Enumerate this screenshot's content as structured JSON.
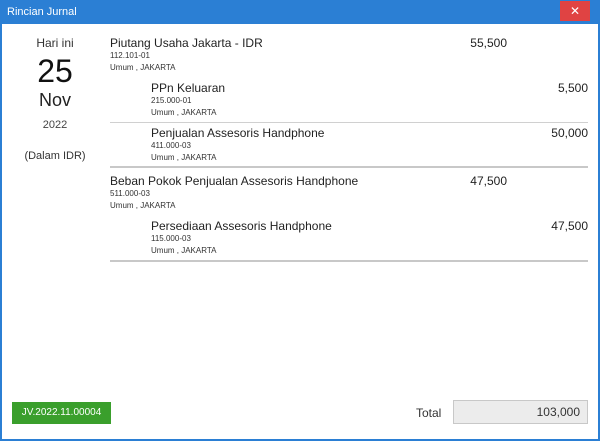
{
  "window": {
    "title": "Rincian Jurnal",
    "close_glyph": "✕",
    "close_icon": "close-icon"
  },
  "date_panel": {
    "label": "Hari ini",
    "day": "25",
    "month": "Nov",
    "year": "2022",
    "currency_note": "(Dalam IDR)"
  },
  "entries": [
    {
      "name": "Piutang Usaha Jakarta - IDR",
      "code": "112.101-01",
      "dept": "Umum , JAKARTA",
      "debit": "55,500",
      "credit": ""
    },
    {
      "name": "PPn Keluaran",
      "code": "215.000-01",
      "dept": "Umum , JAKARTA",
      "debit": "",
      "credit": "5,500"
    },
    {
      "name": "Penjualan Assesoris Handphone",
      "code": "411.000-03",
      "dept": "Umum , JAKARTA",
      "debit": "",
      "credit": "50,000"
    },
    {
      "name": "Beban Pokok Penjualan Assesoris Handphone",
      "code": "511.000-03",
      "dept": "Umum , JAKARTA",
      "debit": "47,500",
      "credit": ""
    },
    {
      "name": "Persediaan Assesoris Handphone",
      "code": "115.000-03",
      "dept": "Umum , JAKARTA",
      "debit": "",
      "credit": "47,500"
    }
  ],
  "footer": {
    "journal_number": "JV.2022.11.00004",
    "total_label": "Total",
    "total_value": "103,000"
  },
  "colors": {
    "titlebar": "#2b7fd4",
    "close": "#e04343",
    "journal_button": "#3a9f2c"
  }
}
